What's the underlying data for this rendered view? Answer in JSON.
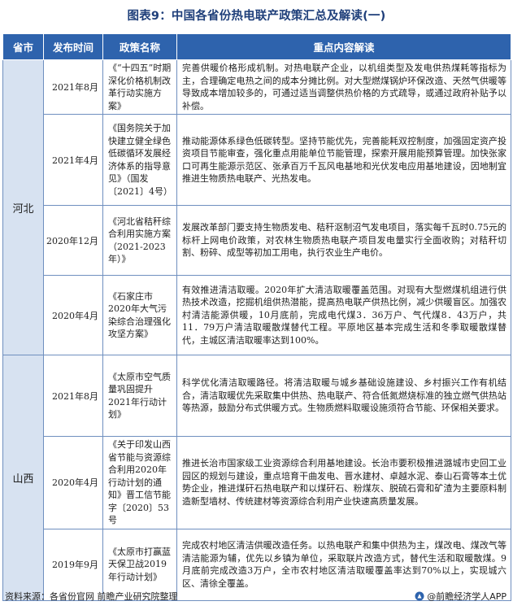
{
  "title": "图表9：中国各省份热电联产政策汇总及解读(一)",
  "table": {
    "headers": [
      "省市",
      "发布时间",
      "政策名称",
      "重点内容解读"
    ],
    "groups": [
      {
        "province": "河北",
        "rows": [
          {
            "date": "2021年8月",
            "name": "《“十四五”时期深化价格机制改革行动实施方案》",
            "content": "完善供暖价格形成机制。对热电联产企业，以机组类型及发电供热煤耗等指标为主，合理确定电热之间的成本分摊比例。对大型燃煤锅炉环保改造、天然气供暖等导致成本增加较多的，可通过适当调整供热价格的方式疏导，或通过政府补贴予以补偿。"
          },
          {
            "date": "2021年4月",
            "name": "《国务院关于加快建立健全绿色低碳循环发展经济体系的指导意见》（国发〔2021〕4号）",
            "content": "推动能源体系绿色低碳转型。坚持节能优先，完善能耗双控制度，加强固定资产投资项目节能审查，强化重点用能单位节能管理，探索开展用能预算管理。加快张家口可再生能源示范区、张承百万千瓦风电基地和光伏发电应用基地建设，因地制宜推进生物质热电联产、光热发电。"
          },
          {
            "date": "2020年12月",
            "name": "《河北省秸秆综合利用实施方案（2021-2023年）》",
            "content": "发展改革部门要支持生物质发电、秸秆沤制沼气发电项目，落实每千瓦时0.75元的标杆上网电价政策，对农林生物质热电联产项目发电量实行全面收购；对秸秆切割、粉碎、成型等初加工用电，执行农业生产电价。"
          },
          {
            "date": "2020年4月",
            "name": "《石家庄市2020年大气污染综合治理强化攻坚方案》",
            "content": "有效推进清洁取暖。2020年扩大清洁取暖覆盖范围。对现有大型燃煤机组进行供热技术改造，挖掘机组供热潜能，提高热电联产供热比例，减少供暖盲区。加强农村清洁能源供暖，10月底前，完成电代煤3．36万户、气代煤8．43万户，共11．79万户清洁取暖散煤替代工程。平原地区基本完成生活和冬季取暖散煤替代，主城区清洁取暖率达到100%。"
          }
        ]
      },
      {
        "province": "山西",
        "rows": [
          {
            "date": "2021年8月",
            "name": "《太原市空气质量巩固提升2021年行动计划》",
            "content": "科学优化清洁取暖路径。将清洁取暖与城乡基础设施建设、乡村振兴工作有机结合，清洁取暖优先采取集中供热、热电联产、符合低氮燃烧标准的独立燃气供热站等热源，鼓励分布式供暖方式。生物质燃料取暖设施须符合节能、环保相关要求。"
          },
          {
            "date": "2020年4月",
            "name": "《关于印发山西省节能与资源综合利用2020年行动计划的通知》晋工信节能字〔2020〕53号",
            "content": "推进长治市国家级工业资源综合利用基地建设。长治市要积极推进潞城市史回工业园区的规划与建设，重点培育干曲发电、晋水建材、卓越水泥、泰山石膏等本土优势企业，推进煤矸石热电联产和以煤矸石、粉煤灰、脱硫石膏和矿渣为主要原料制造新型墙材、传统建材等资源综合利用产业快速高质量发展。"
          },
          {
            "date": "2019年9月",
            "name": "《太原市打赢蓝天保卫战2019年行动计划》",
            "content": "完成农村地区清洁供暖改造任务。以热电联产和集中供热为主，煤改电、煤改气等清洁能源为辅，优先以乡镇为单位，采取联片改造方式，替代生活和取暖散煤。9月底前完成改造3万户，全市农村地区清洁取暖覆盖率达到70%以上，实现城六区、清徐全覆盖。"
          }
        ]
      }
    ]
  },
  "footer": {
    "source": "资料来源：各省份官网 前瞻产业研究院整理",
    "brand": "@前瞻经济学人APP",
    "brand_color": "#2e63ad"
  }
}
